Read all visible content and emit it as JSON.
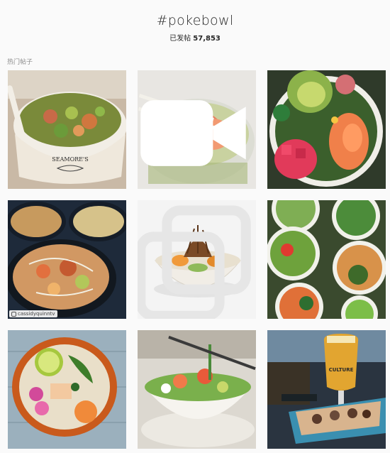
{
  "header": {
    "tag": "#pokebowl",
    "posts_label": "已发帖",
    "posts_count": "57,853"
  },
  "section": {
    "label": "热门帖子"
  },
  "posts": [
    {
      "id": 1,
      "type": "photo",
      "text": "SEAMORE'S"
    },
    {
      "id": 2,
      "type": "video"
    },
    {
      "id": 3,
      "type": "photo"
    },
    {
      "id": 4,
      "type": "photo",
      "credit": "cassidyquinntv"
    },
    {
      "id": 5,
      "type": "carousel"
    },
    {
      "id": 6,
      "type": "photo"
    },
    {
      "id": 7,
      "type": "photo"
    },
    {
      "id": 8,
      "type": "photo"
    },
    {
      "id": 9,
      "type": "photo",
      "text": "CULTURE"
    }
  ],
  "icons": {
    "video": "video-camera-icon",
    "carousel": "multiple-images-icon",
    "credit": "instagram-icon"
  }
}
